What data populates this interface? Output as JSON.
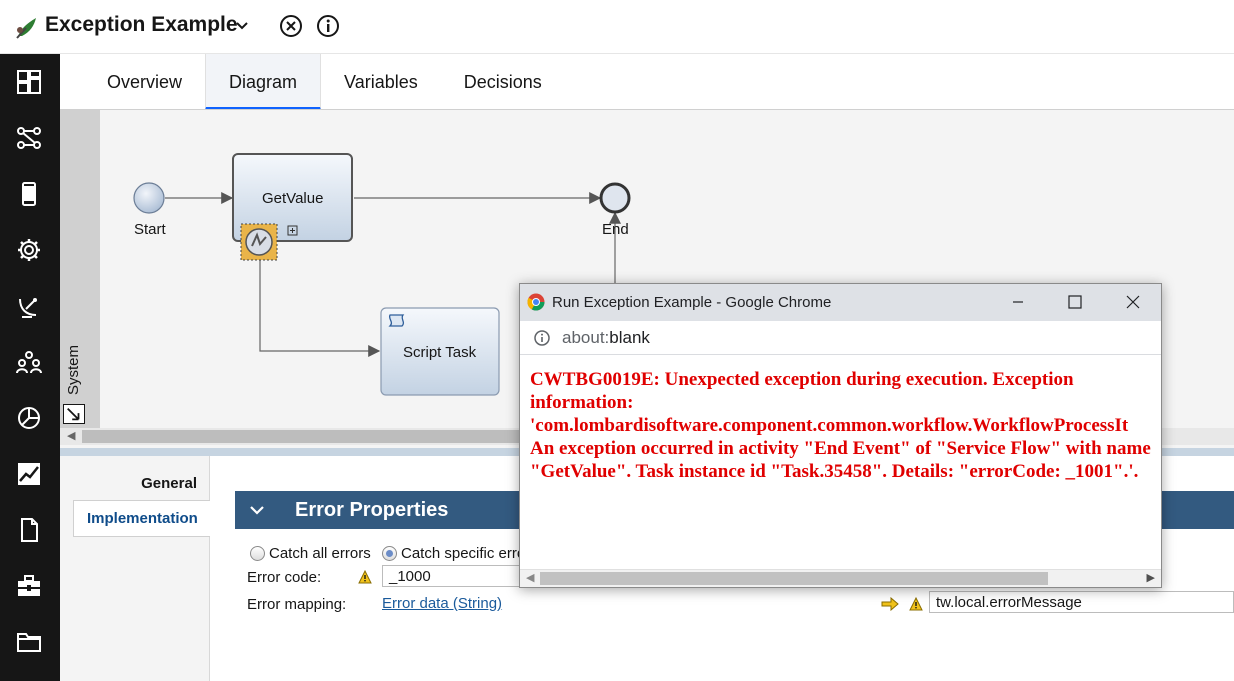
{
  "header": {
    "title": "Exception Example",
    "icons": [
      "leaf-logo-icon",
      "chevron-down-icon",
      "close-circle-icon",
      "info-icon"
    ]
  },
  "leftnav": {
    "items": [
      "dashboard-icon",
      "process-flow-icon",
      "mobile-icon",
      "settings-gear-icon",
      "satellite-dish-icon",
      "team-icon",
      "pie-chart-icon",
      "trend-chart-icon",
      "document-icon",
      "toolbox-icon",
      "folder-icon"
    ]
  },
  "tabs": [
    "Overview",
    "Diagram",
    "Variables",
    "Decisions"
  ],
  "active_tab": "Diagram",
  "diagram": {
    "lane_label": "System",
    "nodes": {
      "start": "Start",
      "getvalue": "GetValue",
      "end": "End",
      "script": "Script Task"
    }
  },
  "properties": {
    "side_tabs": {
      "general": "General",
      "implementation": "Implementation"
    },
    "section_title": "Error Properties",
    "radio_all": "Catch all errors",
    "radio_specific": "Catch specific erro",
    "error_code_label": "Error code:",
    "error_code_value": "_1000",
    "error_mapping_label": "Error mapping:",
    "error_mapping_link": "Error data (String)",
    "error_mapping_target": "tw.local.errorMessage"
  },
  "popup": {
    "title": "Run Exception Example - Google Chrome",
    "url_scheme": "about:",
    "url_host": "blank",
    "message": "CWTBG0019E: Unexpected exception during execution. Exception information:\n'com.lombardisoftware.component.common.workflow.WorkflowProcessIt\nAn exception occurred in activity \"End Event\" of \"Service Flow\" with name \"GetValue\". Task instance id \"Task.35458\". Details: \"errorCode: _1001\".'.",
    "error_color": "#e00000"
  },
  "colors": {
    "accent": "#0f62fe",
    "nav_bg": "#161616",
    "section_header": "#335a80",
    "link": "#1a5a9b"
  }
}
